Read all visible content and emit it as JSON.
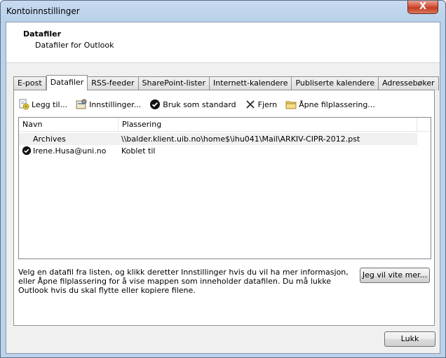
{
  "window": {
    "title": "Kontoinnstillinger",
    "close_label": "X"
  },
  "header": {
    "title": "Datafiler",
    "subtitle": "Datafiler for Outlook"
  },
  "tabs": [
    {
      "label": "E-post"
    },
    {
      "label": "Datafiler",
      "active": true
    },
    {
      "label": "RSS-feeder"
    },
    {
      "label": "SharePoint-lister"
    },
    {
      "label": "Internett-kalendere"
    },
    {
      "label": "Publiserte kalendere"
    },
    {
      "label": "Adressebøker"
    }
  ],
  "toolbar": {
    "add_label": "Legg til...",
    "settings_label": "Innstillinger...",
    "default_label": "Bruk som standard",
    "remove_label": "Fjern",
    "open_location_label": "Åpne filplassering..."
  },
  "list": {
    "columns": [
      "Navn",
      "Plassering"
    ],
    "rows": [
      {
        "name": "Archives",
        "location": "\\\\balder.klient.uib.no\\home$\\ihu041\\Mail\\ARKIV-CIPR-2012.pst",
        "selected": true,
        "default": false
      },
      {
        "name": "Irene.Husa@uni.no",
        "location": "Koblet til",
        "selected": false,
        "default": true
      }
    ]
  },
  "hint": "Velg en datafil fra listen, og klikk deretter Innstillinger hvis du vil ha mer informasjon, eller Åpne filplassering for å vise mappen som inneholder datafilen. Du må lukke Outlook hvis du skal flytte eller kopiere filene.",
  "buttons": {
    "more_label": "Jeg vil vite mer...",
    "close_label": "Lukk"
  }
}
